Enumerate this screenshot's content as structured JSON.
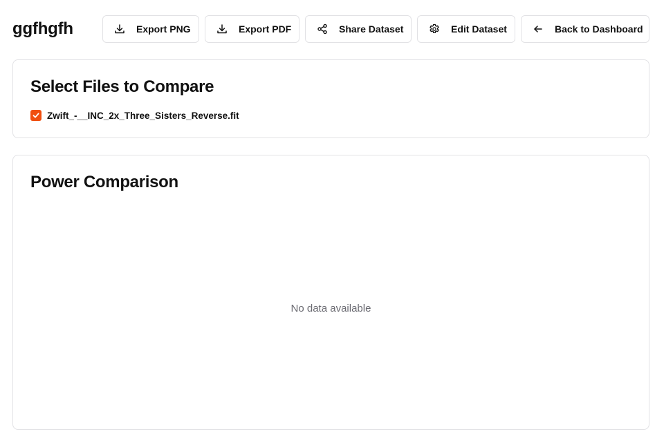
{
  "header": {
    "title": "ggfhgfh"
  },
  "toolbar": {
    "export_png": {
      "label": "Export PNG",
      "icon": "download-icon"
    },
    "export_pdf": {
      "label": "Export PDF",
      "icon": "download-icon"
    },
    "share": {
      "label": "Share Dataset",
      "icon": "share-icon"
    },
    "edit": {
      "label": "Edit Dataset",
      "icon": "gear-icon"
    },
    "back": {
      "label": "Back to Dashboard",
      "icon": "arrow-left-icon"
    }
  },
  "files_card": {
    "title": "Select Files to Compare",
    "files": [
      {
        "name": "Zwift_-__INC_2x_Three_Sisters_Reverse.fit",
        "checked": true
      }
    ]
  },
  "power_card": {
    "title": "Power Comparison",
    "empty_message": "No data available"
  },
  "colors": {
    "accent": "#f04e0e",
    "border": "#e2e2e5",
    "muted_text": "#6b6b72"
  }
}
